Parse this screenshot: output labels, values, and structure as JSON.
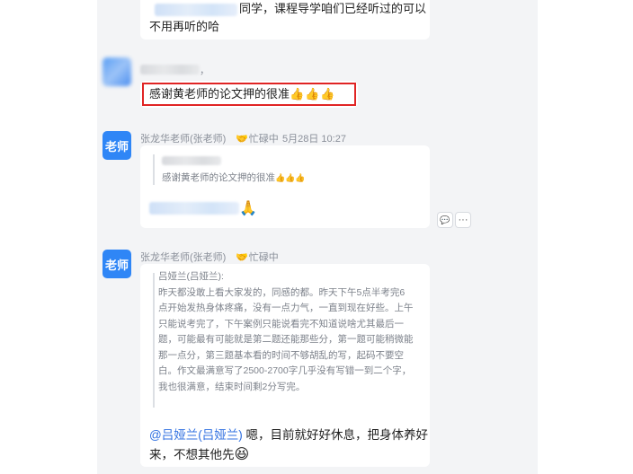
{
  "msg1": {
    "line1": "同学，课程导学咱们已经听过的可以",
    "line2": "不用再听的哈"
  },
  "msg2": {
    "comma": "，",
    "text": "感谢黄老师的论文押的很准",
    "thumbs": "👍👍👍"
  },
  "msg3": {
    "avatar_label": "老师",
    "sender": "张龙华老师(张老师)",
    "status": "忙碌中",
    "timestamp": "5月28日 10:27",
    "quote_text": "感谢黄老师的论文押的很准",
    "quote_thumbs": "👍👍👍",
    "reply_emoji": "🙏"
  },
  "msg4": {
    "avatar_label": "老师",
    "sender": "张龙华老师(张老师)",
    "status": "忙碌中",
    "quote_author": "吕娅兰(吕娅兰):",
    "quote_lines": [
      "昨天都没敢上看大家发的，同感的都。昨天下午5点半考完6",
      "点开始发热身体疼痛，没有一点力气，一直到现在好些。上午",
      "只能说考完了，下午案例只能说看完不知道说啥尤其最后一",
      "题，可能最有可能就是第二题还能那些分，第一题可能稍微能",
      "那一点分，第三题基本看的时间不够胡乱的写，起码不要空",
      "白。作文最满意写了2500-2700字几乎没有写错一到二个字，",
      "我也很满意，结束时间剩2分写完。"
    ],
    "mention": "@吕娅兰(吕娅兰)",
    "reply_line1": " 嗯，目前就好好休息，把身体养好",
    "reply_line2": "来，不想其他先",
    "reply_emoji": "😆"
  },
  "actions": {
    "comment_icon": "speech-bubble-icon",
    "more_icon": "more-icon",
    "more_glyph": "···",
    "comment_glyph": "💬"
  }
}
